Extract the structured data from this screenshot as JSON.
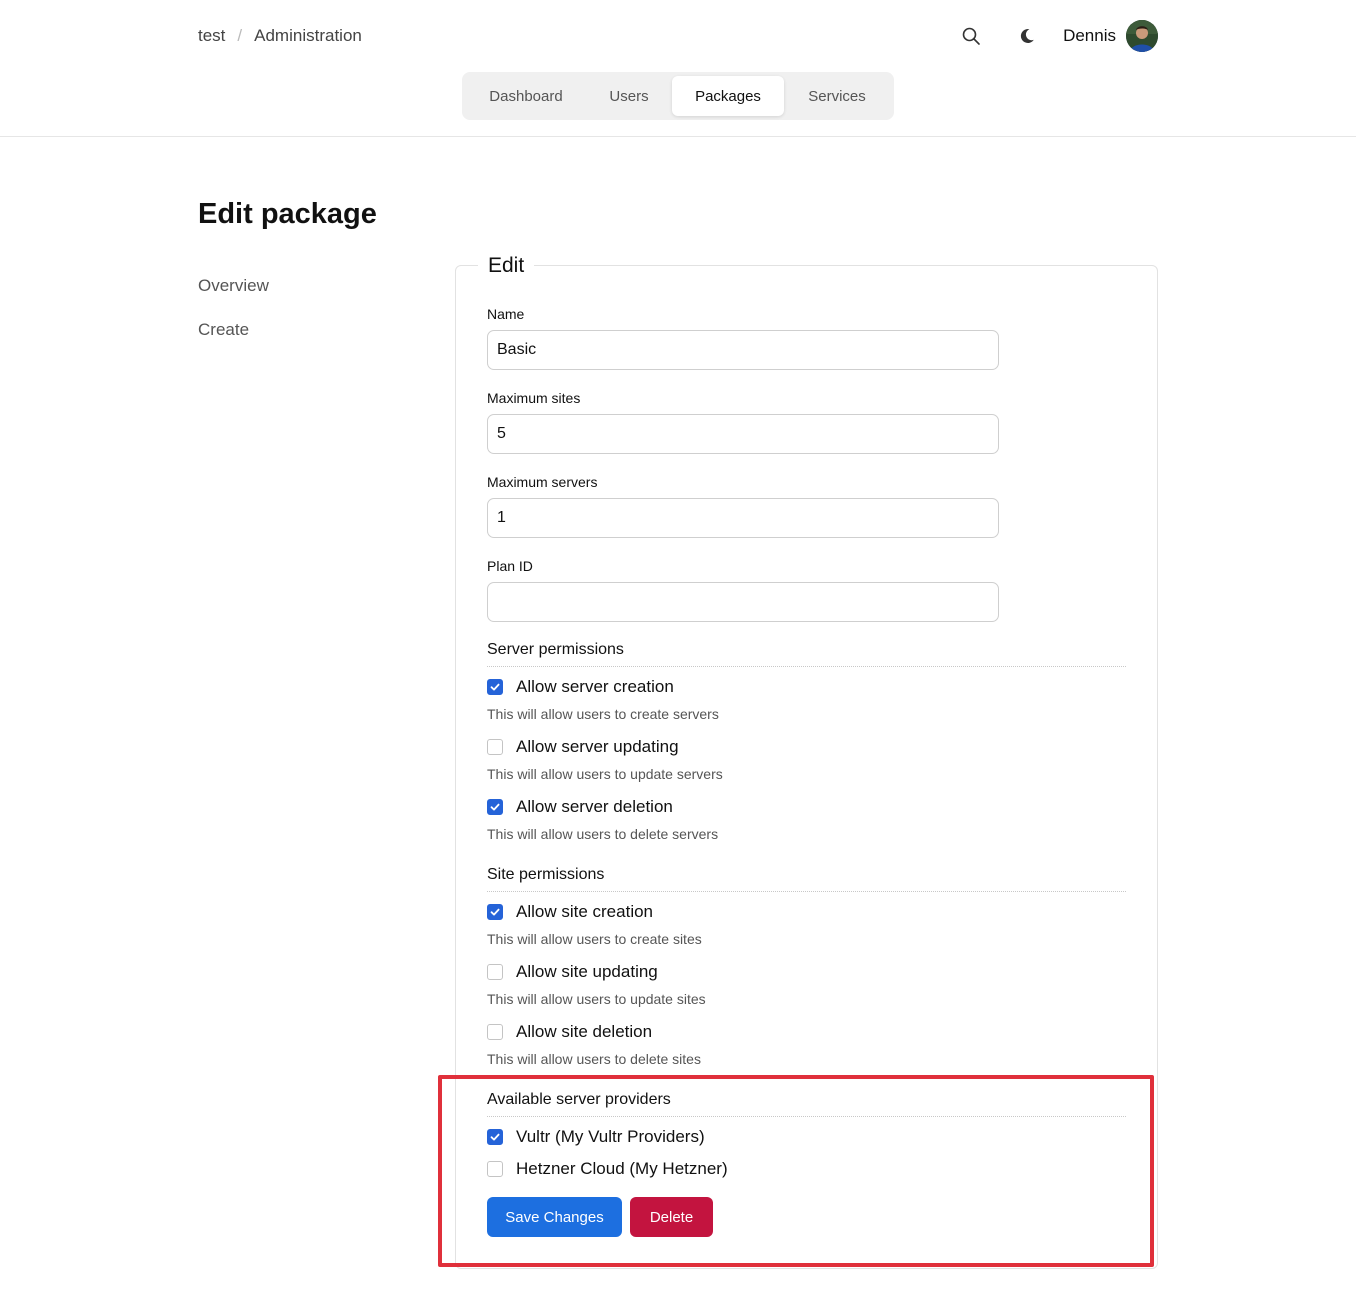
{
  "breadcrumb": {
    "root": "test",
    "separator": "/",
    "current": "Administration"
  },
  "header": {
    "username": "Dennis"
  },
  "tabs": [
    {
      "label": "Dashboard",
      "active": false
    },
    {
      "label": "Users",
      "active": false
    },
    {
      "label": "Packages",
      "active": true
    },
    {
      "label": "Services",
      "active": false
    }
  ],
  "page": {
    "title": "Edit package"
  },
  "side_nav": [
    {
      "label": "Overview"
    },
    {
      "label": "Create"
    }
  ],
  "form": {
    "legend": "Edit",
    "name": {
      "label": "Name",
      "value": "Basic"
    },
    "max_sites": {
      "label": "Maximum sites",
      "value": "5"
    },
    "max_servers": {
      "label": "Maximum servers",
      "value": "1"
    },
    "plan_id": {
      "label": "Plan ID",
      "value": ""
    },
    "server_permissions": {
      "title": "Server permissions",
      "items": [
        {
          "label": "Allow server creation",
          "help": "This will allow users to create servers",
          "checked": true
        },
        {
          "label": "Allow server updating",
          "help": "This will allow users to update servers",
          "checked": false
        },
        {
          "label": "Allow server deletion",
          "help": "This will allow users to delete servers",
          "checked": true
        }
      ]
    },
    "site_permissions": {
      "title": "Site permissions",
      "items": [
        {
          "label": "Allow site creation",
          "help": "This will allow users to create sites",
          "checked": true
        },
        {
          "label": "Allow site updating",
          "help": "This will allow users to update sites",
          "checked": false
        },
        {
          "label": "Allow site deletion",
          "help": "This will allow users to delete sites",
          "checked": false
        }
      ]
    },
    "providers": {
      "title": "Available server providers",
      "items": [
        {
          "label": "Vultr (My Vultr Providers)",
          "checked": true
        },
        {
          "label": "Hetzner Cloud (My Hetzner)",
          "checked": false
        }
      ]
    },
    "save_label": "Save Changes",
    "delete_label": "Delete"
  },
  "colors": {
    "accent": "#1d6fe0",
    "checkbox": "#2563d8",
    "danger": "#c3143f",
    "highlight": "#e0303b"
  },
  "icons": {
    "search": "search-icon",
    "theme": "moon-icon",
    "check": "check-icon"
  }
}
